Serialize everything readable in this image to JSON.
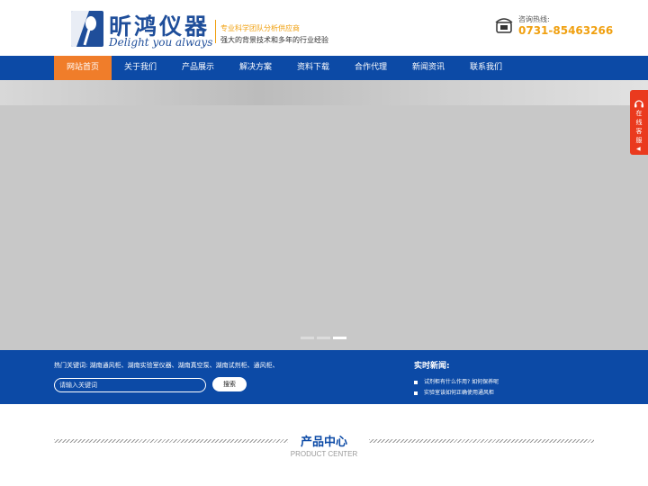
{
  "header": {
    "brand_cn": "昕鸿仪器",
    "brand_en": "Delight you always",
    "tagline_1": "专业科学团队分析供应商",
    "tagline_2": "强大的背景技术和多年的行业经验",
    "hotline_label": "咨询热线:",
    "hotline_number": "0731-85463266"
  },
  "nav": {
    "items": [
      {
        "label": "网站首页",
        "active": true
      },
      {
        "label": "关于我们"
      },
      {
        "label": "产品展示"
      },
      {
        "label": "解决方案"
      },
      {
        "label": "资料下载"
      },
      {
        "label": "合作代理"
      },
      {
        "label": "新闻资讯"
      },
      {
        "label": "联系我们"
      }
    ]
  },
  "banner": {
    "slide_count": 3,
    "active_slide": 3
  },
  "float_service": {
    "label": "在线客服"
  },
  "search": {
    "hot_keywords": "热门关键词: 湖南通风柜、湖南实验室仪器、湖南真空泵、湖南试剂柜、通风柜、",
    "placeholder": "请输入关键词",
    "button_label": "搜索"
  },
  "news": {
    "title": "实时新闻:",
    "items": [
      "试剂柜有什么作用? 如何保养呢",
      "实验室该如何正确使用通风柜"
    ]
  },
  "section": {
    "title": "产品中心",
    "subtitle": "PRODUCT CENTER"
  },
  "colors": {
    "primary": "#0c4aa6",
    "accent": "#f07d2a",
    "gold": "#f0a010",
    "float_red": "#ea3a1e"
  }
}
